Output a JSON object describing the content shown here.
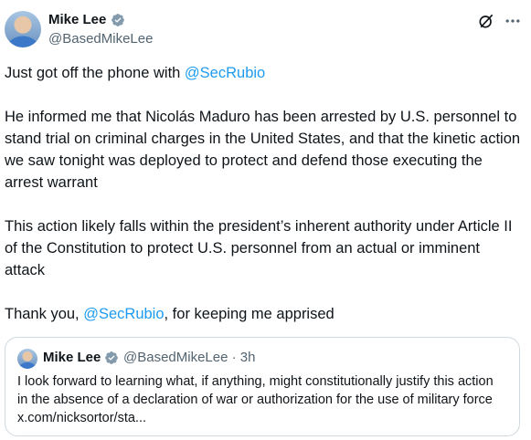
{
  "author": {
    "name": "Mike Lee",
    "handle": "@BasedMikeLee"
  },
  "icons": {
    "verified": "verified-badge-icon",
    "grok": "grok-icon",
    "more": "more-options-icon"
  },
  "colors": {
    "link": "#1d9bf0",
    "verified": "#829aab",
    "secondary_text": "#536471",
    "border": "#cfd9de"
  },
  "post": {
    "p1_text": "Just got off the phone with ",
    "p1_mention": "@SecRubio",
    "p2": "He informed me that Nicolás Maduro has been arrested by U.S. personnel to stand trial on criminal charges in the United States, and that the kinetic action we saw tonight was deployed to protect and defend those executing the arrest warrant",
    "p3": "This action likely falls within the president’s inherent authority under Article II of the Constitution to protect U.S. personnel from an actual or imminent attack",
    "p4_pre": "Thank you, ",
    "p4_mention": "@SecRubio",
    "p4_post": ", for keeping me apprised"
  },
  "quote": {
    "name": "Mike Lee",
    "handle_time": "@BasedMikeLee · 3h",
    "text": "I look forward to learning what, if anything, might constitutionally justify this action in the absence of a declaration of war or authorization for the use of military force x.com/nicksortor/sta..."
  }
}
